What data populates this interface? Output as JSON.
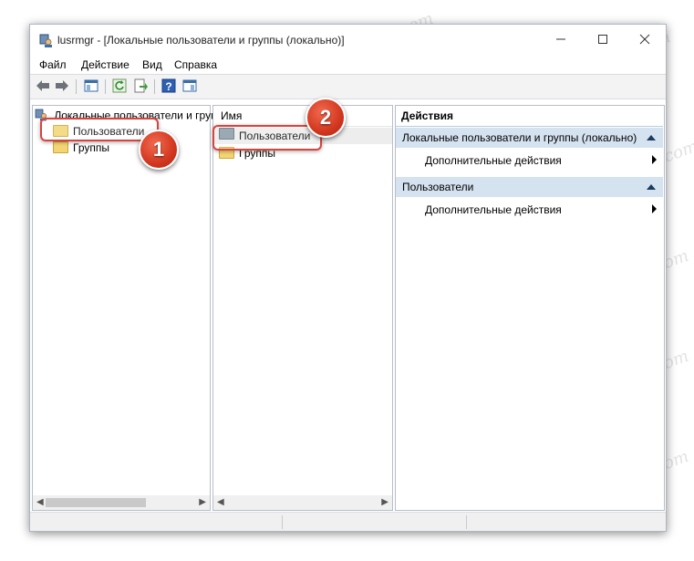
{
  "window": {
    "title": "lusrmgr - [Локальные пользователи и группы (локально)]"
  },
  "menu": [
    "Файл",
    "Действие",
    "Вид",
    "Справка"
  ],
  "tree": {
    "root": "Локальные пользователи и группы (локально)",
    "items": [
      "Пользователи",
      "Группы"
    ]
  },
  "list": {
    "column_name": "Имя",
    "items": [
      "Пользователи",
      "Группы"
    ]
  },
  "actions": {
    "title": "Действия",
    "sections": [
      {
        "header": "Локальные пользователи и группы (локально)",
        "item": "Дополнительные действия"
      },
      {
        "header": "Пользователи",
        "item": "Дополнительные действия"
      }
    ]
  },
  "status": {
    "text": ""
  },
  "badges": [
    "1",
    "2"
  ],
  "watermark": "Soringpcrepair.com",
  "colors": {
    "highlight_border": "#d9443e",
    "badge": "#d2371f",
    "action_header": "#d5e2f0"
  },
  "icons": [
    "app-icon",
    "back-arrow-icon",
    "forward-arrow-icon",
    "show-hide-tree-icon",
    "refresh-icon",
    "export-list-icon",
    "help-icon",
    "show-hide-action-pane-icon",
    "folder-icon",
    "user-icon"
  ]
}
